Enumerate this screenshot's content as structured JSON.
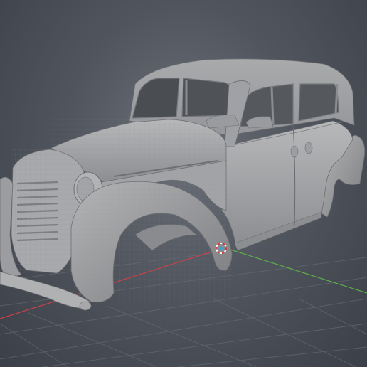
{
  "viewport": {
    "kind": "3d-modeling-viewport",
    "background_color": "#5a5f68",
    "model_color": "#a3a4a6",
    "grid_color": "#6a6e76",
    "axis_x_color": "#c8404a",
    "axis_y_color": "#5fae4a"
  },
  "scene": {
    "object_name": "",
    "shading": "solid",
    "wireframe_overlay": true
  },
  "cursor": {
    "icon": "3d-cursor-icon",
    "ring_color_a": "#d23a3a",
    "ring_color_b": "#ffffff"
  }
}
